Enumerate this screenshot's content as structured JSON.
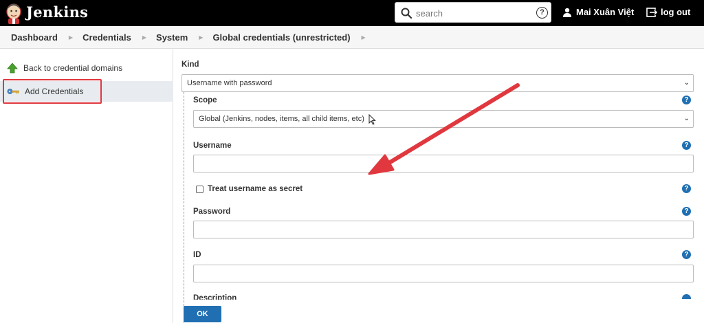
{
  "header": {
    "brand": "Jenkins",
    "search_placeholder": "search",
    "help_glyph": "?",
    "user_name": "Mai Xuân Việt",
    "logout_label": "log out"
  },
  "breadcrumb": {
    "items": [
      "Dashboard",
      "Credentials",
      "System",
      "Global credentials (unrestricted)"
    ]
  },
  "sidebar": {
    "items": [
      {
        "label": "Back to credential domains",
        "icon": "up-arrow-icon"
      },
      {
        "label": "Add Credentials",
        "icon": "key-icon"
      }
    ]
  },
  "form": {
    "kind_label": "Kind",
    "kind_value": "Username with password",
    "scope_label": "Scope",
    "scope_value": "Global (Jenkins, nodes, items, all child items, etc)",
    "username_label": "Username",
    "username_value": "",
    "treat_secret_label": "Treat username as secret",
    "treat_secret_checked": false,
    "password_label": "Password",
    "password_value": "",
    "id_label": "ID",
    "id_value": "",
    "description_label": "Description",
    "ok_label": "OK"
  },
  "colors": {
    "header_bg": "#000000",
    "accent_blue": "#1f6fb2",
    "annotation_red": "#e0383e"
  }
}
